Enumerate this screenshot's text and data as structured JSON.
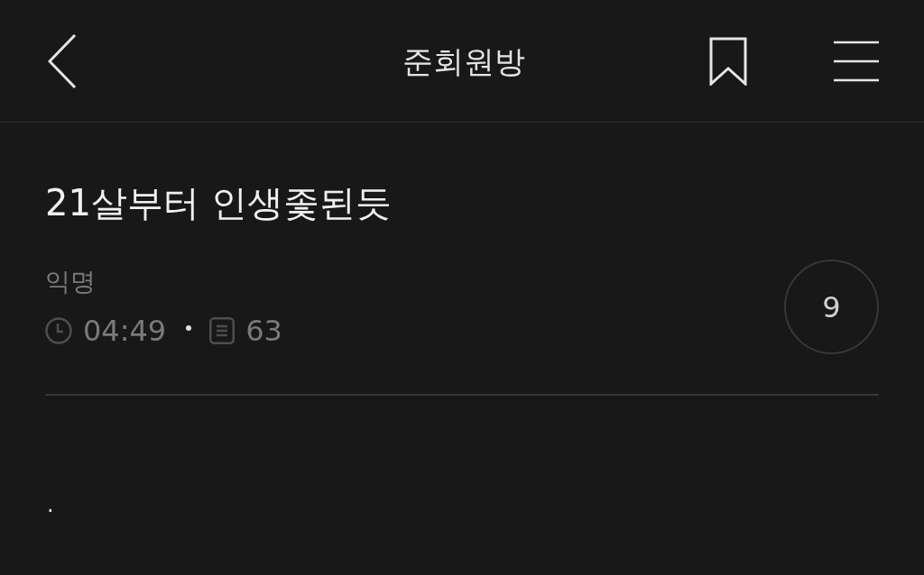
{
  "header": {
    "title": "준회원방"
  },
  "post": {
    "title": "21살부터 인생좇된듯",
    "author": "익명",
    "meta": {
      "time": "04:49",
      "count": "63"
    },
    "circle_count": "9",
    "body": "."
  }
}
